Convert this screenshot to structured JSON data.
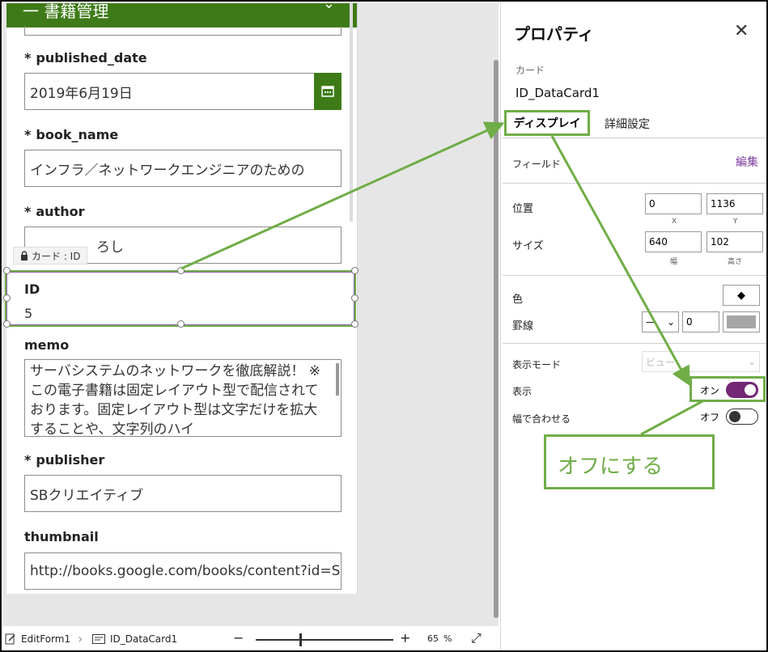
{
  "form": {
    "header_title": "一 書籍管理",
    "fields": [
      {
        "label": "published_date",
        "required": true,
        "value": "2019年6月19日"
      },
      {
        "label": "book_name",
        "required": true,
        "value": "インフラ／ネットワークエンジニアのための"
      },
      {
        "label": "author",
        "required": true,
        "value": "ろし"
      },
      {
        "label": "ID",
        "required": false,
        "value": "5"
      },
      {
        "label": "memo",
        "required": false,
        "value": "サーバシステムのネットワークを徹底解説！ ※この電子書籍は固定レイアウト型で配信されております。固定レイアウト型は文字だけを拡大することや、文字列のハイ"
      },
      {
        "label": "publisher",
        "required": true,
        "value": "SBクリエイティブ"
      },
      {
        "label": "thumbnail",
        "required": false,
        "value": "http://books.google.com/books/content?id=S"
      }
    ],
    "required_mark": "*",
    "card_tag": "カード : ID"
  },
  "bottombar": {
    "form_name": "EditForm1",
    "card_name": "ID_DataCard1",
    "zoom_minus": "−",
    "zoom_plus": "+",
    "zoom_value": "65",
    "zoom_unit": "%"
  },
  "panel": {
    "title": "プロパティ",
    "subtitle": "カード",
    "card_name": "ID_DataCard1",
    "tabs": [
      "ディスプレイ",
      "詳細設定"
    ],
    "field_label": "フィールド",
    "edit_link": "編集",
    "position_label": "位置",
    "position_x": "0",
    "position_y": "1136",
    "x_caption": "X",
    "y_caption": "Y",
    "size_label": "サイズ",
    "width": "640",
    "height": "102",
    "width_caption": "幅",
    "height_caption": "高さ",
    "color_label": "色",
    "border_label": "罫線",
    "border_style": "—",
    "border_width": "0",
    "display_mode_label": "表示モード",
    "display_mode_value": "ビュー",
    "visible_label": "表示",
    "visible_state": "オン",
    "fit_width_label": "幅で合わせる",
    "fit_width_state": "オフ"
  },
  "annotation": {
    "callout_text": "オフにする"
  },
  "colors": {
    "form_header": "#3e7b18",
    "annotation_green": "#70ad47",
    "toggle_on": "#742774",
    "selection_purple": "#8a63a9"
  }
}
